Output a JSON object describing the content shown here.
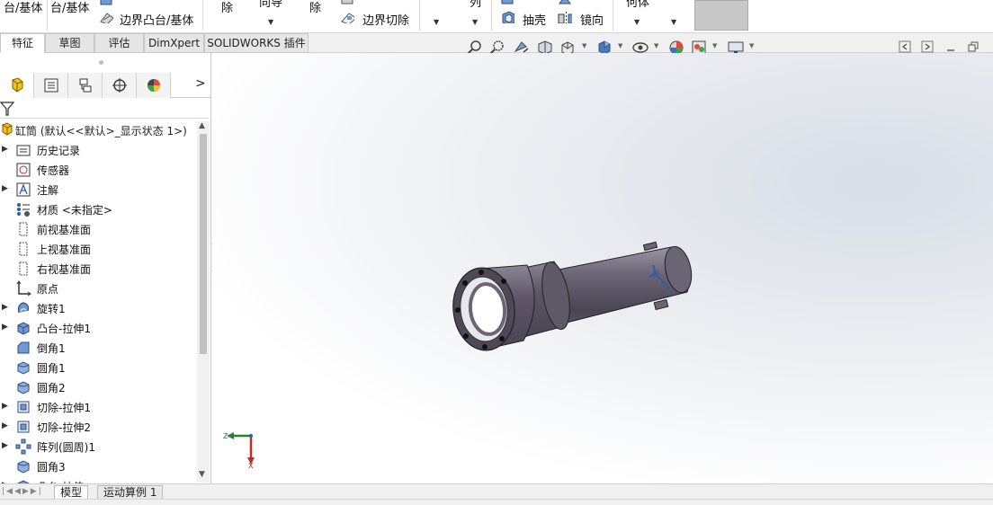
{
  "ribbon": {
    "btn_boss_line1": "台/基体",
    "btn_revolve_line1": "台/基体",
    "btn_boundary_boss": "边界凸台/基体",
    "btn_chu_1": "除",
    "btn_xiangdao": "向导",
    "btn_chu_2": "除",
    "btn_boundary_cut": "边界切除",
    "btn_lie": "列",
    "btn_shell": "抽壳",
    "btn_mirror": "镜向",
    "btn_quti": "何体"
  },
  "tabs": [
    "特征",
    "草图",
    "评估",
    "DimXpert",
    "SOLIDWORKS 插件"
  ],
  "panel": {
    "root_label": "缸筒  (默认<<默认>_显示状态 1>)",
    "items": [
      {
        "label": "历史记录",
        "icon": "history-folder-icon",
        "expand": true
      },
      {
        "label": "传感器",
        "icon": "sensor-icon",
        "expand": false
      },
      {
        "label": "注解",
        "icon": "annotation-icon",
        "expand": true
      },
      {
        "label": "材质 <未指定>",
        "icon": "material-icon",
        "expand": false
      },
      {
        "label": "前视基准面",
        "icon": "plane-icon",
        "expand": false
      },
      {
        "label": "上视基准面",
        "icon": "plane-icon",
        "expand": false
      },
      {
        "label": "右视基准面",
        "icon": "plane-icon",
        "expand": false
      },
      {
        "label": "原点",
        "icon": "origin-icon",
        "expand": false
      },
      {
        "label": "旋转1",
        "icon": "revolve-icon",
        "expand": true
      },
      {
        "label": "凸台-拉伸1",
        "icon": "extrude-icon",
        "expand": true
      },
      {
        "label": "倒角1",
        "icon": "chamfer-icon",
        "expand": false
      },
      {
        "label": "圆角1",
        "icon": "fillet-icon",
        "expand": false
      },
      {
        "label": "圆角2",
        "icon": "fillet-icon",
        "expand": false
      },
      {
        "label": "切除-拉伸1",
        "icon": "cut-extrude-icon",
        "expand": true
      },
      {
        "label": "切除-拉伸2",
        "icon": "cut-extrude-icon",
        "expand": true
      },
      {
        "label": "阵列(圆周)1",
        "icon": "circular-pattern-icon",
        "expand": true
      },
      {
        "label": "圆角3",
        "icon": "fillet-icon",
        "expand": false
      },
      {
        "label": "凸台-拉伸",
        "icon": "extrude-icon",
        "expand": true
      }
    ]
  },
  "triad": {
    "x": "X",
    "z": "Z"
  },
  "bottom_tabs": [
    "模型",
    "运动算例 1"
  ],
  "colors": {
    "model_body": "#5d5566",
    "model_highlight": "#8b8394",
    "accent_blue": "#2a5caa"
  }
}
